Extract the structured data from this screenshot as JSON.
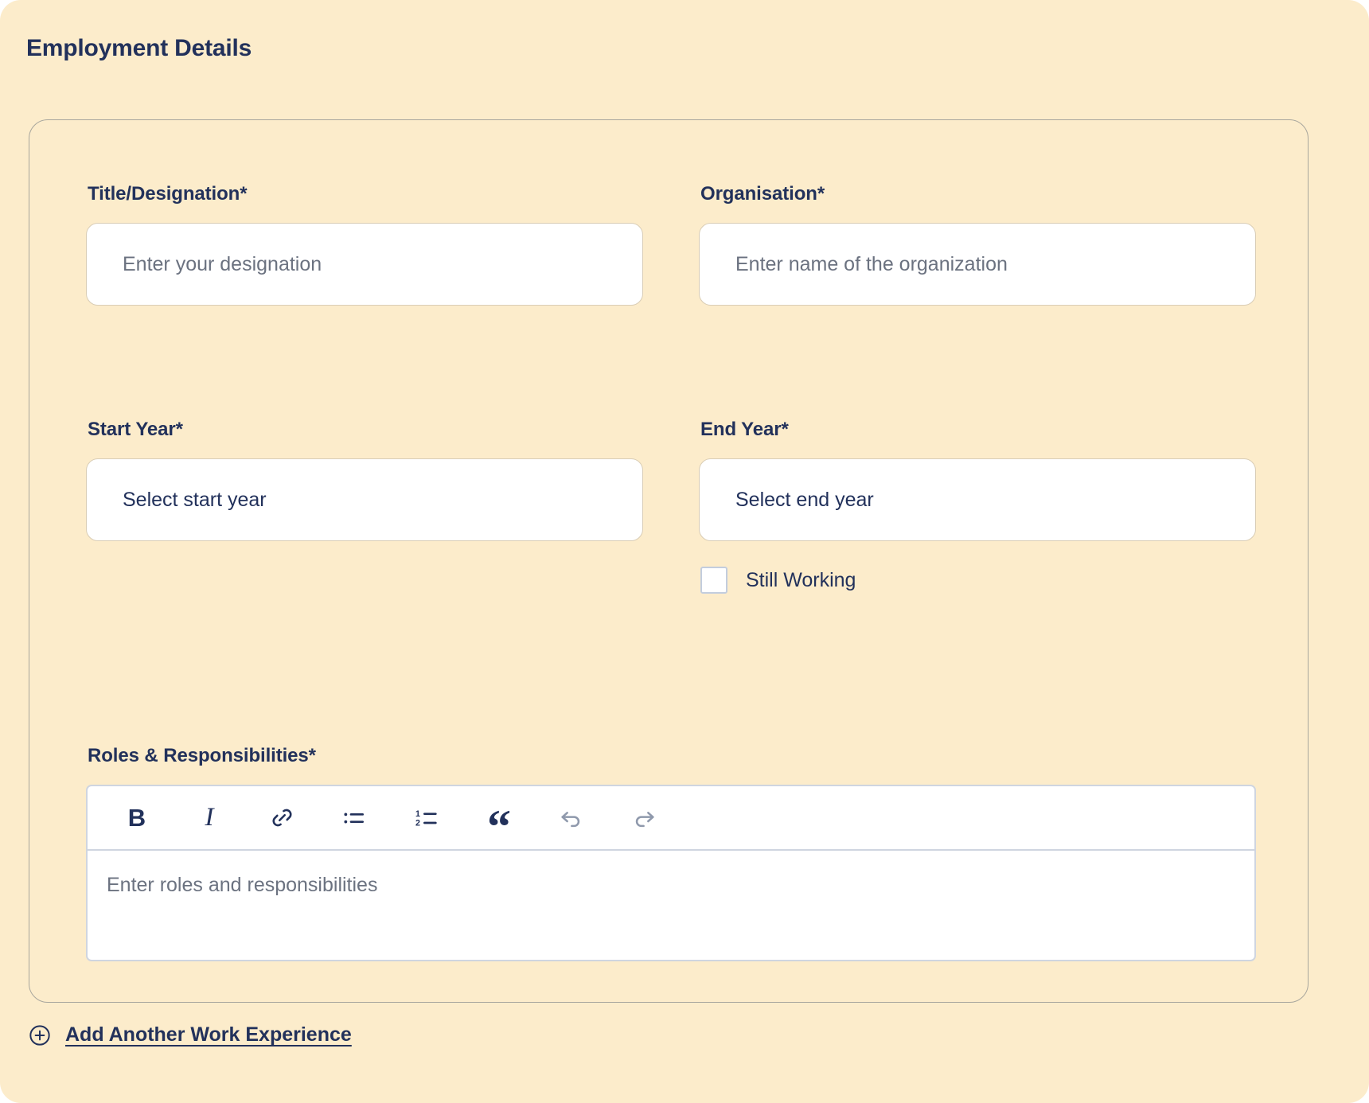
{
  "section": {
    "title": "Employment Details"
  },
  "colors": {
    "page_background": "#fceccb",
    "text_primary": "#22315b",
    "placeholder": "#6b7280",
    "card_border": "#a8a69d",
    "input_border": "#d9cdb6",
    "editor_border": "#cfd5e0",
    "toolbar_disabled": "#8f99ac",
    "checkbox_border": "#c3cdde"
  },
  "fields": {
    "title_designation": {
      "label": "Title/Designation*",
      "placeholder": "Enter your designation",
      "value": ""
    },
    "organisation": {
      "label": "Organisation*",
      "placeholder": "Enter name of the organization",
      "value": ""
    },
    "start_year": {
      "label": "Start Year*",
      "placeholder": "Select start year",
      "value": "Select start year"
    },
    "end_year": {
      "label": "End Year*",
      "placeholder": "Select end year",
      "value": "Select end year"
    },
    "still_working": {
      "label": "Still Working",
      "checked": false
    },
    "roles_responsibilities": {
      "label": "Roles & Responsibilities*",
      "placeholder": "Enter roles and responsibilities",
      "value": ""
    }
  },
  "editor_toolbar": {
    "buttons": [
      {
        "name": "bold-icon",
        "glyph": "B",
        "label": "Bold",
        "disabled": false
      },
      {
        "name": "italic-icon",
        "glyph": "I",
        "label": "Italic",
        "disabled": false
      },
      {
        "name": "link-icon",
        "glyph": "",
        "label": "Link",
        "disabled": false
      },
      {
        "name": "bullet-list-icon",
        "glyph": "",
        "label": "Bulleted list",
        "disabled": false
      },
      {
        "name": "numbered-list-icon",
        "glyph": "",
        "label": "Numbered list",
        "disabled": false
      },
      {
        "name": "blockquote-icon",
        "glyph": "“",
        "label": "Blockquote",
        "disabled": false
      },
      {
        "name": "undo-icon",
        "glyph": "",
        "label": "Undo",
        "disabled": true
      },
      {
        "name": "redo-icon",
        "glyph": "",
        "label": "Redo",
        "disabled": true
      }
    ]
  },
  "add_experience": {
    "label": "Add Another Work Experience",
    "icon": "plus-circle-icon"
  }
}
